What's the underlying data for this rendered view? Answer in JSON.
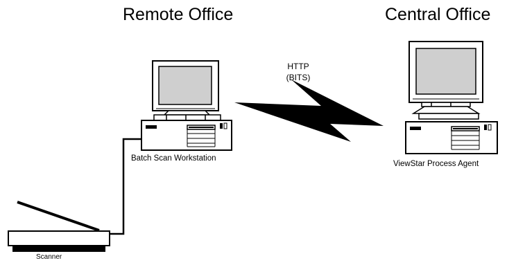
{
  "headings": {
    "remote": "Remote Office",
    "central": "Central Office"
  },
  "link": {
    "protocol_line1": "HTTP",
    "protocol_line2": "(BITS)"
  },
  "devices": {
    "workstation_label": "Batch Scan Workstation",
    "agent_label": "ViewStar Process Agent",
    "scanner_label": "Scanner"
  }
}
